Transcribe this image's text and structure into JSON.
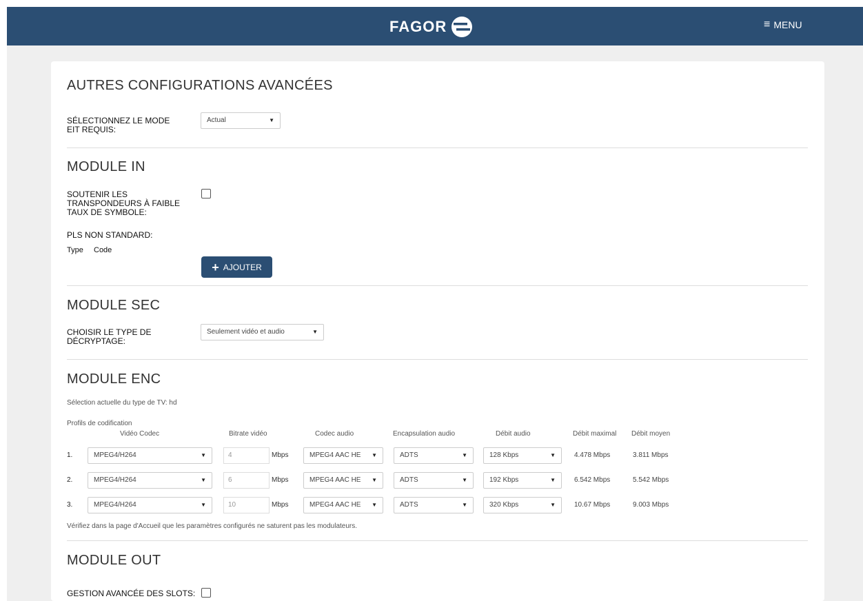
{
  "header": {
    "logo_text": "FAGOR",
    "menu_label": "MENU"
  },
  "advanced": {
    "title": "AUTRES CONFIGURATIONS AVANCÉES",
    "eit_label": "SÉLECTIONNEZ LE MODE EIT REQUIS:",
    "eit_value": "Actual"
  },
  "module_in": {
    "title": "MODULE IN",
    "low_rate_label": "SOUTENIR LES TRANSPONDEURS À FAIBLE TAUX DE SYMBOLE:",
    "low_rate_checked": false,
    "pls_label": "PLS NON STANDARD:",
    "type_header": "Type",
    "code_header": "Code",
    "add_button": "AJOUTER"
  },
  "module_sec": {
    "title": "MODULE SEC",
    "decrypt_label": "CHOISIR LE TYPE DE DÉCRYPTAGE:",
    "decrypt_value": "Seulement vidéo et audio"
  },
  "module_enc": {
    "title": "MODULE ENC",
    "tv_type_text": "Sélection actuelle du type de TV: hd",
    "profiles_label": "Profils de codification",
    "columns": {
      "video_codec": "Vidéo Codec",
      "video_bitrate": "Bitrate vidéo",
      "audio_codec": "Codec audio",
      "audio_encapsulation": "Encapsulation audio",
      "audio_rate": "Débit audio",
      "max_rate": "Débit maximal",
      "avg_rate": "Débit moyen"
    },
    "unit": "Mbps",
    "rows": [
      {
        "num": "1.",
        "video_codec": "MPEG4/H264",
        "bitrate": "4",
        "audio_codec": "MPEG4 AAC HE",
        "encapsulation": "ADTS",
        "audio_rate": "128 Kbps",
        "max_rate": "4.478 Mbps",
        "avg_rate": "3.811 Mbps"
      },
      {
        "num": "2.",
        "video_codec": "MPEG4/H264",
        "bitrate": "6",
        "audio_codec": "MPEG4 AAC HE",
        "encapsulation": "ADTS",
        "audio_rate": "192 Kbps",
        "max_rate": "6.542 Mbps",
        "avg_rate": "5.542 Mbps"
      },
      {
        "num": "3.",
        "video_codec": "MPEG4/H264",
        "bitrate": "10",
        "audio_codec": "MPEG4 AAC HE",
        "encapsulation": "ADTS",
        "audio_rate": "320 Kbps",
        "max_rate": "10.67 Mbps",
        "avg_rate": "9.003 Mbps"
      }
    ],
    "note": "Vérifiez dans la page d'Accueil que les paramètres configurés ne saturent pas les modulateurs."
  },
  "module_out": {
    "title": "MODULE OUT",
    "slots_label": "GESTION AVANCÉE DES SLOTS:",
    "slots_checked": false
  },
  "colors": {
    "header_bg": "#2b4e73",
    "button_bg": "#2b4e73",
    "page_bg": "#efefef"
  }
}
